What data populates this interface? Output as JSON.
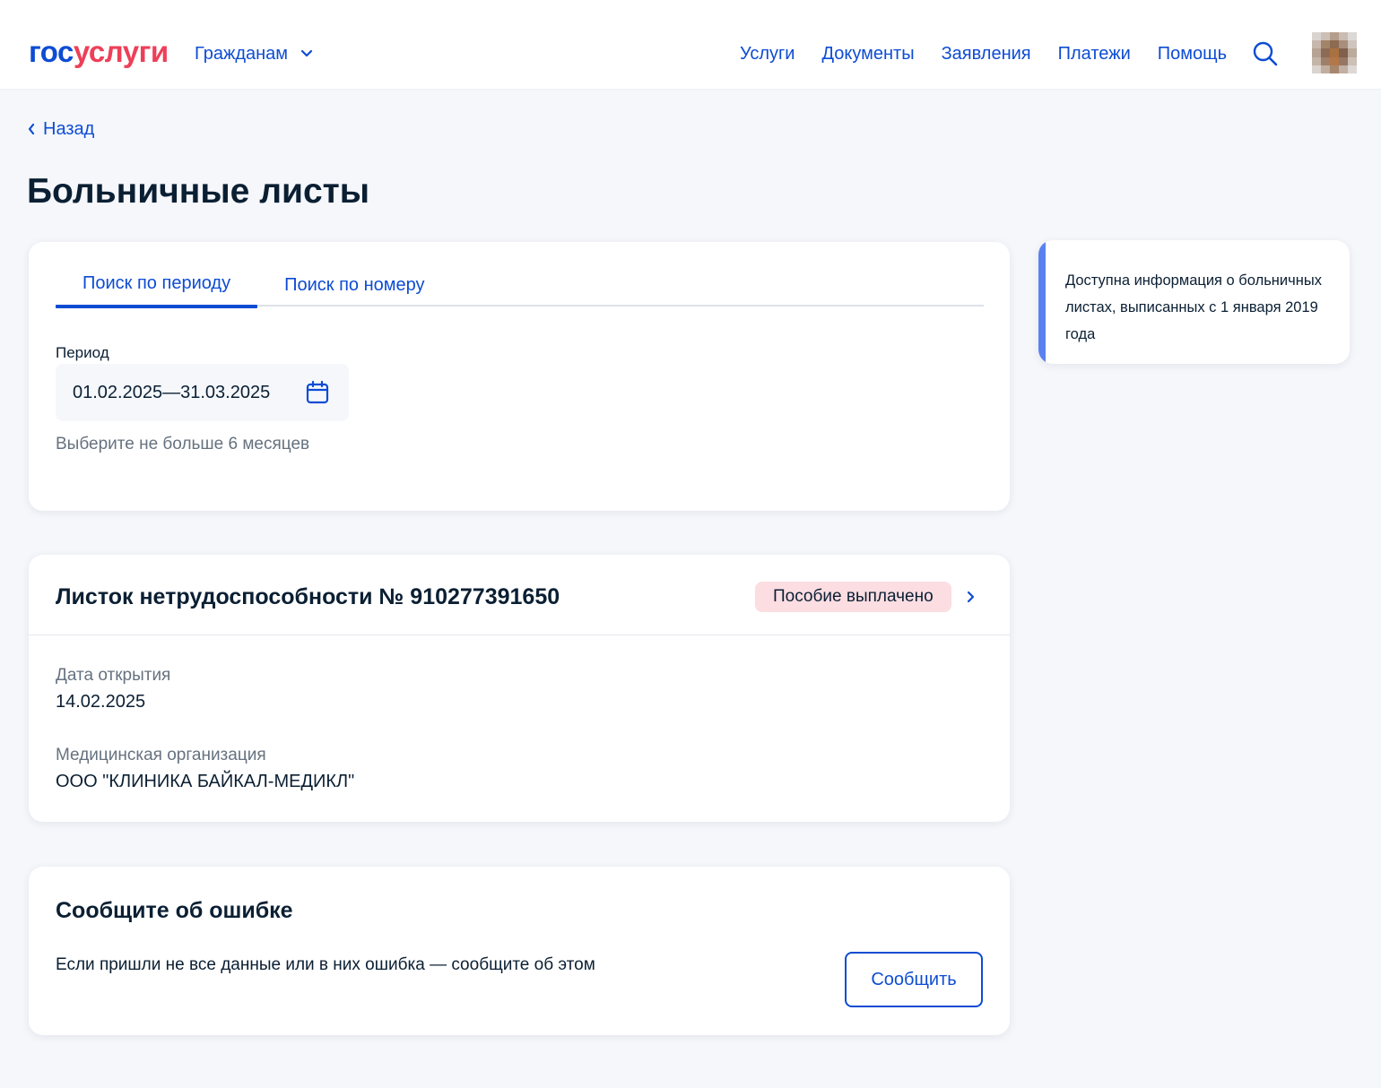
{
  "header": {
    "logo_part1": "гос",
    "logo_part2": "услуги",
    "citizens_label": "Гражданам",
    "nav": [
      "Услуги",
      "Документы",
      "Заявления",
      "Платежи",
      "Помощь"
    ]
  },
  "back_label": "Назад",
  "page_title": "Больничные листы",
  "search": {
    "tabs": [
      "Поиск по периоду",
      "Поиск по номеру"
    ],
    "active_tab": "Поиск по периоду",
    "period_label": "Период",
    "period_value": "01.02.2025—31.03.2025",
    "hint": "Выберите не больше 6 месяцев"
  },
  "info": {
    "text": "Доступна информация о больничных листах, выписанных с 1 января 2019 года"
  },
  "leave": {
    "title": "Листок нетрудоспособности № 910277391650",
    "status": "Пособие выплачено",
    "open_date_label": "Дата открытия",
    "open_date": "14.02.2025",
    "org_label": "Медицинская организация",
    "org": "ООО \"КЛИНИКА БАЙКАЛ-МЕДИКЛ\""
  },
  "report": {
    "title": "Сообщите об ошибке",
    "text": "Если пришли не все данные или в них ошибка — сообщите об этом",
    "button": "Сообщить"
  },
  "colors": {
    "brand_blue": "#0d4cd3",
    "brand_red": "#ee3f58",
    "info_bar": "#5a81f0",
    "badge_bg": "#fbdde2",
    "page_bg": "#f5f7fb"
  },
  "icons": {
    "citizens_dropdown": "chevron-down-icon",
    "search": "search-icon",
    "back": "chevron-left-icon",
    "calendar": "calendar-icon",
    "leave_open": "chevron-right-icon"
  }
}
